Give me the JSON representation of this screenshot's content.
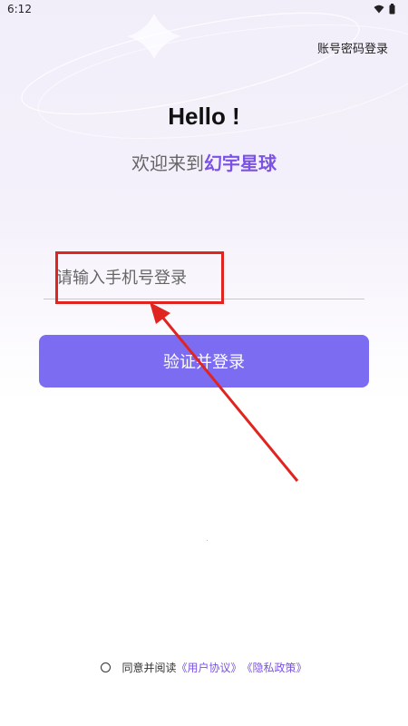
{
  "status_bar": {
    "time": "6:12",
    "icons": [
      "wifi-icon",
      "battery-icon"
    ]
  },
  "header": {
    "account_login": "账号密码登录"
  },
  "main": {
    "hello": "Hello !",
    "welcome_prefix": "欢迎来到",
    "brand": "幻宇星球",
    "phone_placeholder": "请输入手机号登录",
    "verify_button": "验证并登录"
  },
  "footer": {
    "agree_text": "同意并阅读",
    "user_agreement": "《用户协议》",
    "privacy_policy": "《隐私政策》"
  },
  "colors": {
    "accent": "#7b6cf2",
    "brand_text": "#7b52e3",
    "annotation_red": "#e0241f"
  }
}
